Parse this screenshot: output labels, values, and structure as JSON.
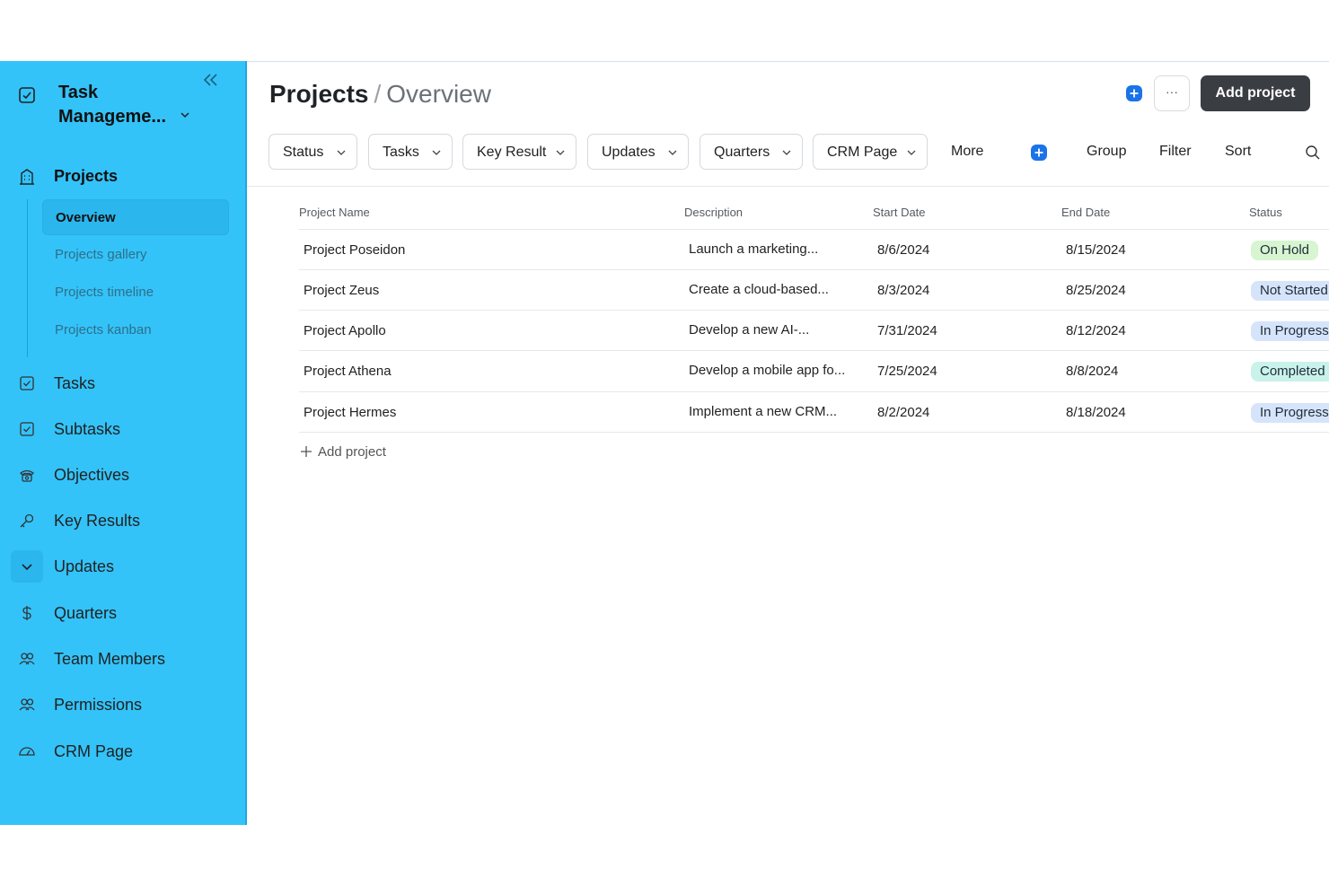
{
  "workspace": {
    "title": "Task\nManageme...",
    "collapse_icon": "collapse-left-icon"
  },
  "sidebar": {
    "projects_label": "Projects",
    "subitems": [
      "Overview",
      "Projects gallery",
      "Projects timeline",
      "Projects kanban"
    ],
    "items": [
      {
        "label": "Tasks",
        "icon": "checkbox-icon"
      },
      {
        "label": "Subtasks",
        "icon": "checkbox-icon"
      },
      {
        "label": "Objectives",
        "icon": "phone-icon"
      },
      {
        "label": "Key Results",
        "icon": "key-icon"
      },
      {
        "label": "Updates",
        "icon": "chevron-down-icon"
      },
      {
        "label": "Quarters",
        "icon": "dollar-icon"
      },
      {
        "label": "Team Members",
        "icon": "people-icon"
      },
      {
        "label": "Permissions",
        "icon": "people-icon"
      },
      {
        "label": "CRM Page",
        "icon": "gauge-icon"
      }
    ]
  },
  "header": {
    "title": "Projects",
    "separator": "/",
    "crumb": "Overview",
    "more_label": "···",
    "add_label": "Add project"
  },
  "tabs": [
    "Status",
    "Tasks",
    "Key Result",
    "Updates",
    "Quarters",
    "CRM Page"
  ],
  "toolbar": {
    "more": "More",
    "group": "Group",
    "filter": "Filter",
    "sort": "Sort"
  },
  "table": {
    "headers": [
      "Project Name",
      "Description",
      "Start Date",
      "End Date",
      "Status"
    ],
    "rows": [
      {
        "name": "Project Poseidon",
        "description": "Launch a marketing...",
        "start": "8/6/2024",
        "end": "8/15/2024",
        "status": "On Hold"
      },
      {
        "name": "Project Zeus",
        "description": "Create a cloud-based...",
        "start": "8/3/2024",
        "end": "8/25/2024",
        "status": "Not Started"
      },
      {
        "name": "Project Apollo",
        "description": "Develop a new AI-...",
        "start": "7/31/2024",
        "end": "8/12/2024",
        "status": "In Progress"
      },
      {
        "name": "Project Athena",
        "description": "Develop a mobile app fo...",
        "start": "7/25/2024",
        "end": "8/8/2024",
        "status": "Completed"
      },
      {
        "name": "Project Hermes",
        "description": "Implement a new CRM...",
        "start": "8/2/2024",
        "end": "8/18/2024",
        "status": "In Progress"
      }
    ],
    "add_label": "Add project"
  },
  "colors": {
    "sidebar": "#33c3f9",
    "accent": "#1a73e8",
    "on_hold": "#d7f5d0",
    "not_started": "#d6e4fb",
    "in_progress": "#d6e4fb",
    "completed": "#c9f2ea"
  }
}
